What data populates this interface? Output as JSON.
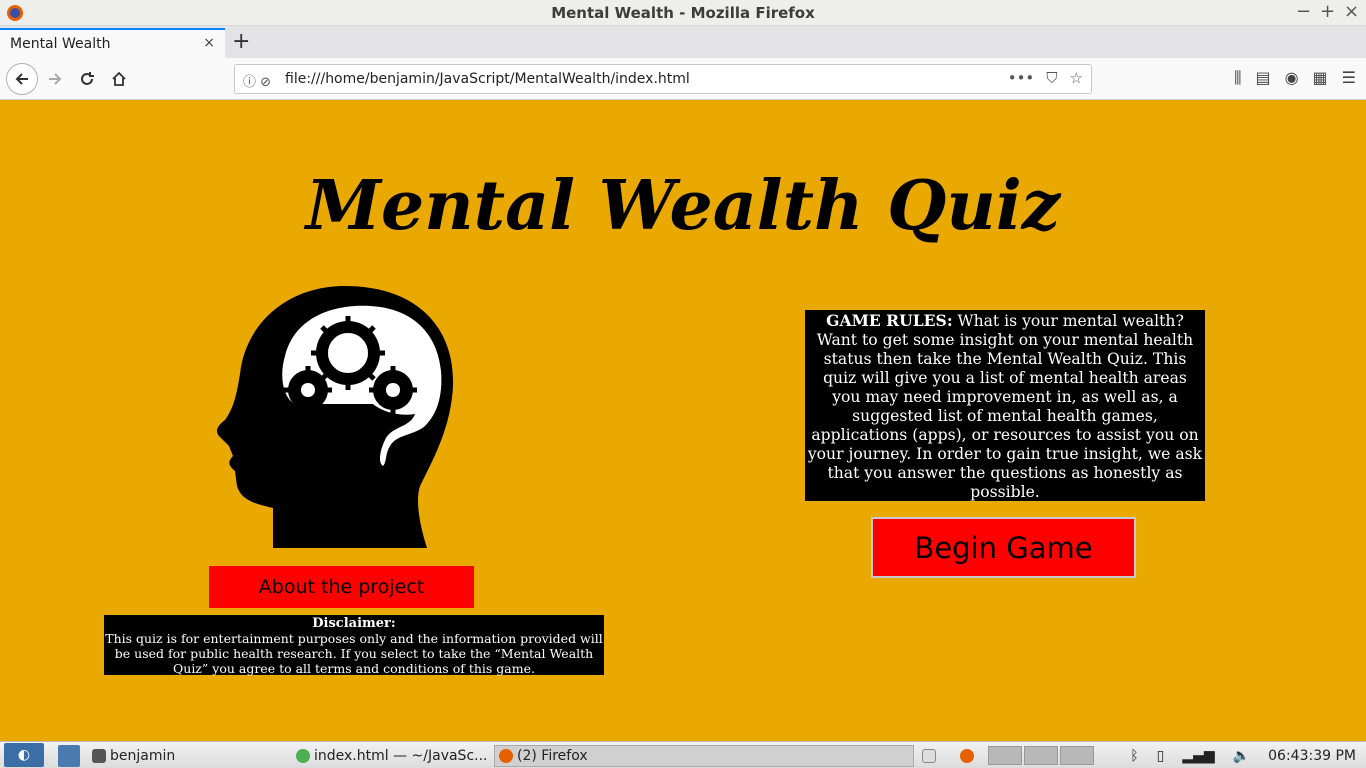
{
  "window": {
    "title": "Mental Wealth - Mozilla Firefox",
    "controls": [
      "−",
      "+",
      "×"
    ]
  },
  "tab": {
    "title": "Mental Wealth",
    "close": "×",
    "new_tab": "+"
  },
  "nav": {
    "url": "file:///home/benjamin/JavaScript/MentalWealth/index.html",
    "url_more": "•••"
  },
  "page": {
    "title": "Mental Wealth Quiz",
    "about_button": "About the project",
    "disclaimer_heading": "Disclaimer:",
    "disclaimer_text": "This quiz is for entertainment purposes only and the information provided will be used for public health research. If you select to take the “Mental Wealth Quiz” you agree to all terms and conditions of this game.",
    "rules_heading": "GAME RULES:",
    "rules_text": " What is your mental wealth? Want to get some insight on your mental health status then take the Mental Wealth Quiz. This quiz will give you a list of mental health areas you may need improvement in, as well as, a suggested list of mental health games, applications (apps), or resources to assist you on your journey. In order to gain true insight, we ask that you answer the questions as honestly as possible.",
    "begin_button": "Begin Game",
    "background_color": "#eaa900",
    "button_color": "#ff0000"
  },
  "taskbar": {
    "folder_label": "benjamin",
    "editor_label": "index.html — ~/JavaSc...",
    "firefox_label": "(2) Firefox",
    "clock": "06:43:39 PM"
  }
}
